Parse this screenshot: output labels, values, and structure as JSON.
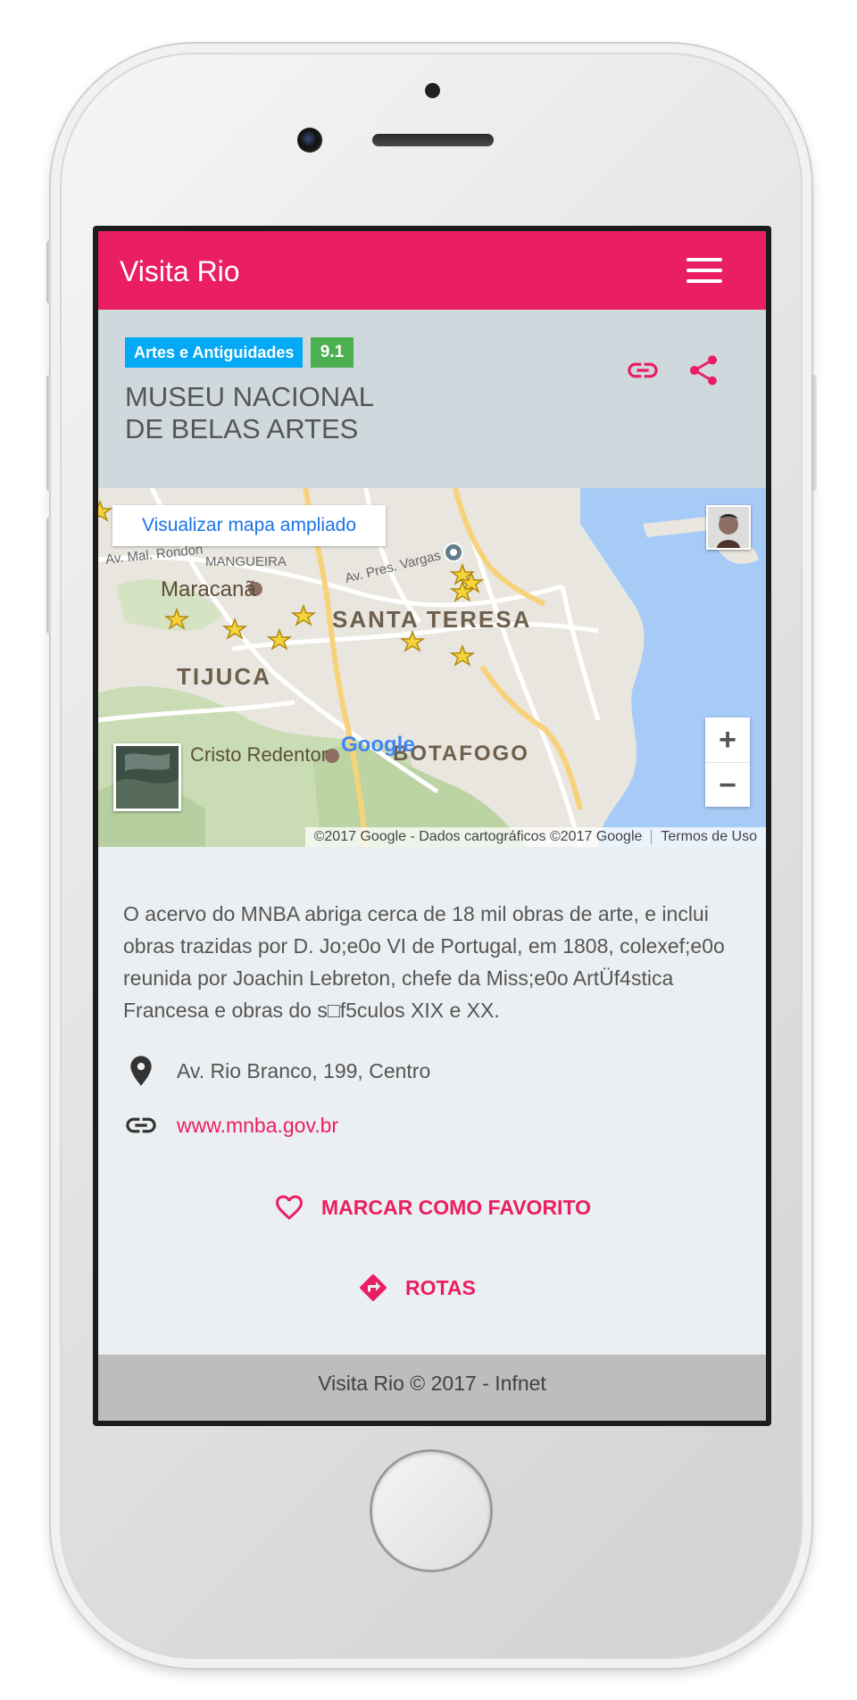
{
  "app": {
    "title": "Visita Rio",
    "menu_icon": "hamburger-menu-icon"
  },
  "place": {
    "category": "Artes e Antiguidades",
    "score": "9.1",
    "title_line1": "MUSEU NACIONAL",
    "title_line2": "DE BELAS ARTES",
    "actions": {
      "link_icon": "link-icon",
      "share_icon": "share-icon"
    }
  },
  "map": {
    "expand_label": "Visualizar mapa ampliado",
    "zoom_in": "+",
    "zoom_out": "−",
    "attribution": "©2017 Google - Dados cartográficos ©2017 Google",
    "terms": "Termos de Uso",
    "labels": {
      "av_mal_rondon": "Av. Mal. Rondon",
      "mangueira": "MANGUEIRA",
      "maracana": "Maracanã",
      "av_pres_vargas": "Av. Pres. Vargas",
      "santa_teresa": "SANTA TERESA",
      "tijuca": "TIJUCA",
      "cristo_redentor": "Cristo Redentor",
      "botafogo": "BOTAFOGO",
      "google": "Google"
    }
  },
  "details": {
    "description": "O acervo do MNBA abriga cerca de 18 mil obras de arte, e inclui obras trazidas por D. Jo;e0o VI de Portugal, em 1808, colexef;e0o reunida por Joachin Lebreton, chefe da Miss;e0o ArtÜf4stica Francesa e obras do s□f5culos XIX e XX.",
    "address": "Av. Rio Branco, 199, Centro",
    "website": "www.mnba.gov.br"
  },
  "actions": {
    "favorite_label": "MARCAR COMO FAVORITO",
    "routes_label": "ROTAS"
  },
  "footer": {
    "text": "Visita Rio © 2017 - Infnet"
  },
  "colors": {
    "accent": "#e91e63",
    "header_bg": "#cfd8dc",
    "page_bg": "#eceff1",
    "category_badge": "#03a9f4",
    "score_badge": "#4caf50",
    "footer_bg": "#bdbdbd"
  }
}
